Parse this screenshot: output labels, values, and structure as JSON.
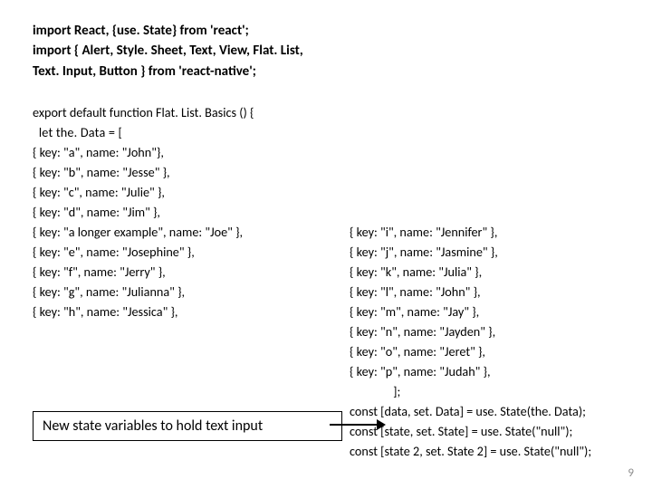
{
  "top": {
    "l1": "import React, {use. State} from 'react';",
    "l2": "import { Alert, Style. Sheet, Text, View, Flat. List,",
    "l3": "Text. Input, Button } from 'react-native';"
  },
  "left": {
    "l0": "export default function Flat. List. Basics () {",
    "l1": "  let the. Data = [",
    "l2": "{ key: \"a\", name: \"John\"},",
    "l3": "{ key: \"b\", name: \"Jesse\" },",
    "l4": "{ key: \"c\", name: \"Julie\" },",
    "l5": "{ key: \"d\", name: \"Jim\" },",
    "l6": "{ key: \"a longer example\", name: \"Joe\" },",
    "l7": "{ key: \"e\", name: \"Josephine\" },",
    "l8": "{ key: \"f\", name: \"Jerry\" },",
    "l9": "{ key: \"g\", name: \"Julianna\" },",
    "l10": "{ key: \"h\", name: \"Jessica\" },"
  },
  "right": {
    "l1": "{ key: \"i\", name: \"Jennifer\" },",
    "l2": "{ key: \"j\", name: \"Jasmine\" },",
    "l3": "{ key: \"k\", name: \"Julia\" },",
    "l4": "{ key: \"l\", name: \"John\" },",
    "l5": "{ key: \"m\", name: \"Jay\" },",
    "l6": "{ key: \"n\", name: \"Jayden\" },",
    "l7": "{ key: \"o\", name: \"Jeret\" },",
    "l8": "{ key: \"p\", name: \"Judah\" },",
    "l9": "               ];",
    "l10": "const [data, set. Data] = use. State(the. Data);",
    "l11": "const [state, set. State] = use. State(\"null\");",
    "l12": "const [state 2, set. State 2] = use. State(\"null\");"
  },
  "caption": "New state variables to hold text input",
  "page_number": "9"
}
